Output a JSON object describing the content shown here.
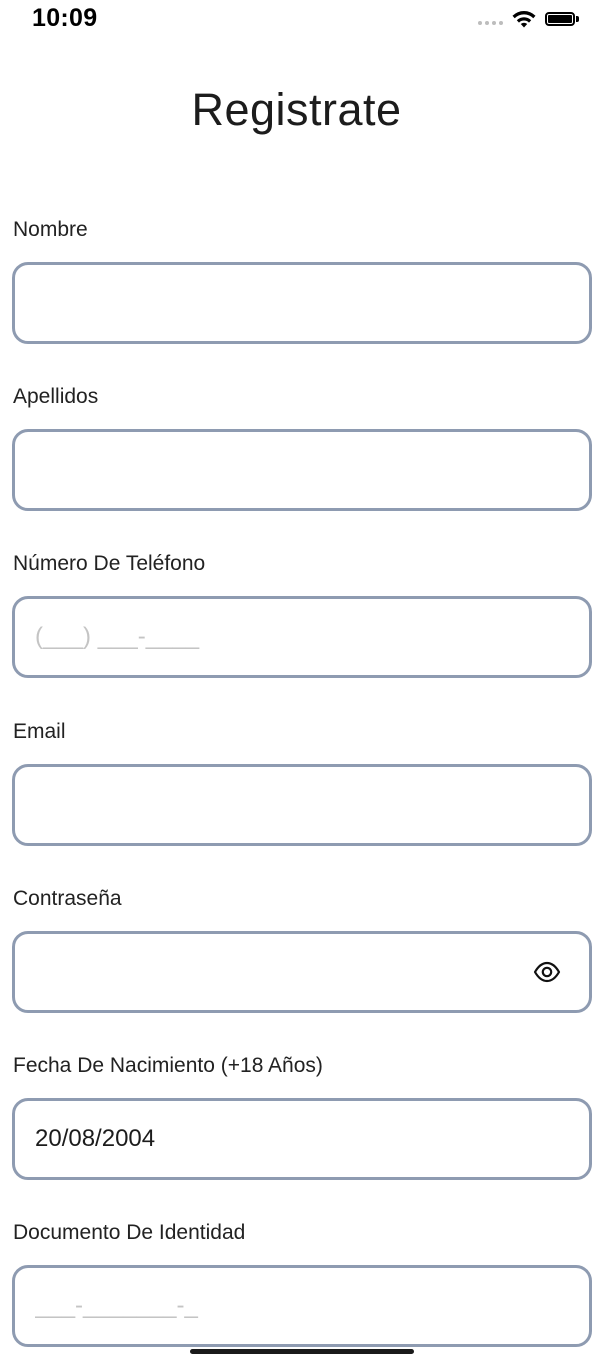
{
  "status_bar": {
    "time": "10:09"
  },
  "page": {
    "title": "Registrate"
  },
  "form": {
    "nombre": {
      "label": "Nombre",
      "value": "",
      "placeholder": ""
    },
    "apellidos": {
      "label": "Apellidos",
      "value": "",
      "placeholder": ""
    },
    "telefono": {
      "label": "Número De Teléfono",
      "value": "",
      "placeholder": "(___) ___-____"
    },
    "email": {
      "label": "Email",
      "value": "",
      "placeholder": ""
    },
    "contrasena": {
      "label": "Contraseña",
      "value": "",
      "placeholder": "",
      "toggle_icon": "eye-icon"
    },
    "fecha_nacimiento": {
      "label": "Fecha De Nacimiento (+18 Años)",
      "value": "20/08/2004",
      "placeholder": ""
    },
    "documento": {
      "label": "Documento De Identidad",
      "value": "",
      "placeholder": "___-_______-_"
    }
  },
  "colors": {
    "field_border": "#8e9bb1",
    "placeholder": "#c4c4c4",
    "text": "#1c1c1c"
  }
}
